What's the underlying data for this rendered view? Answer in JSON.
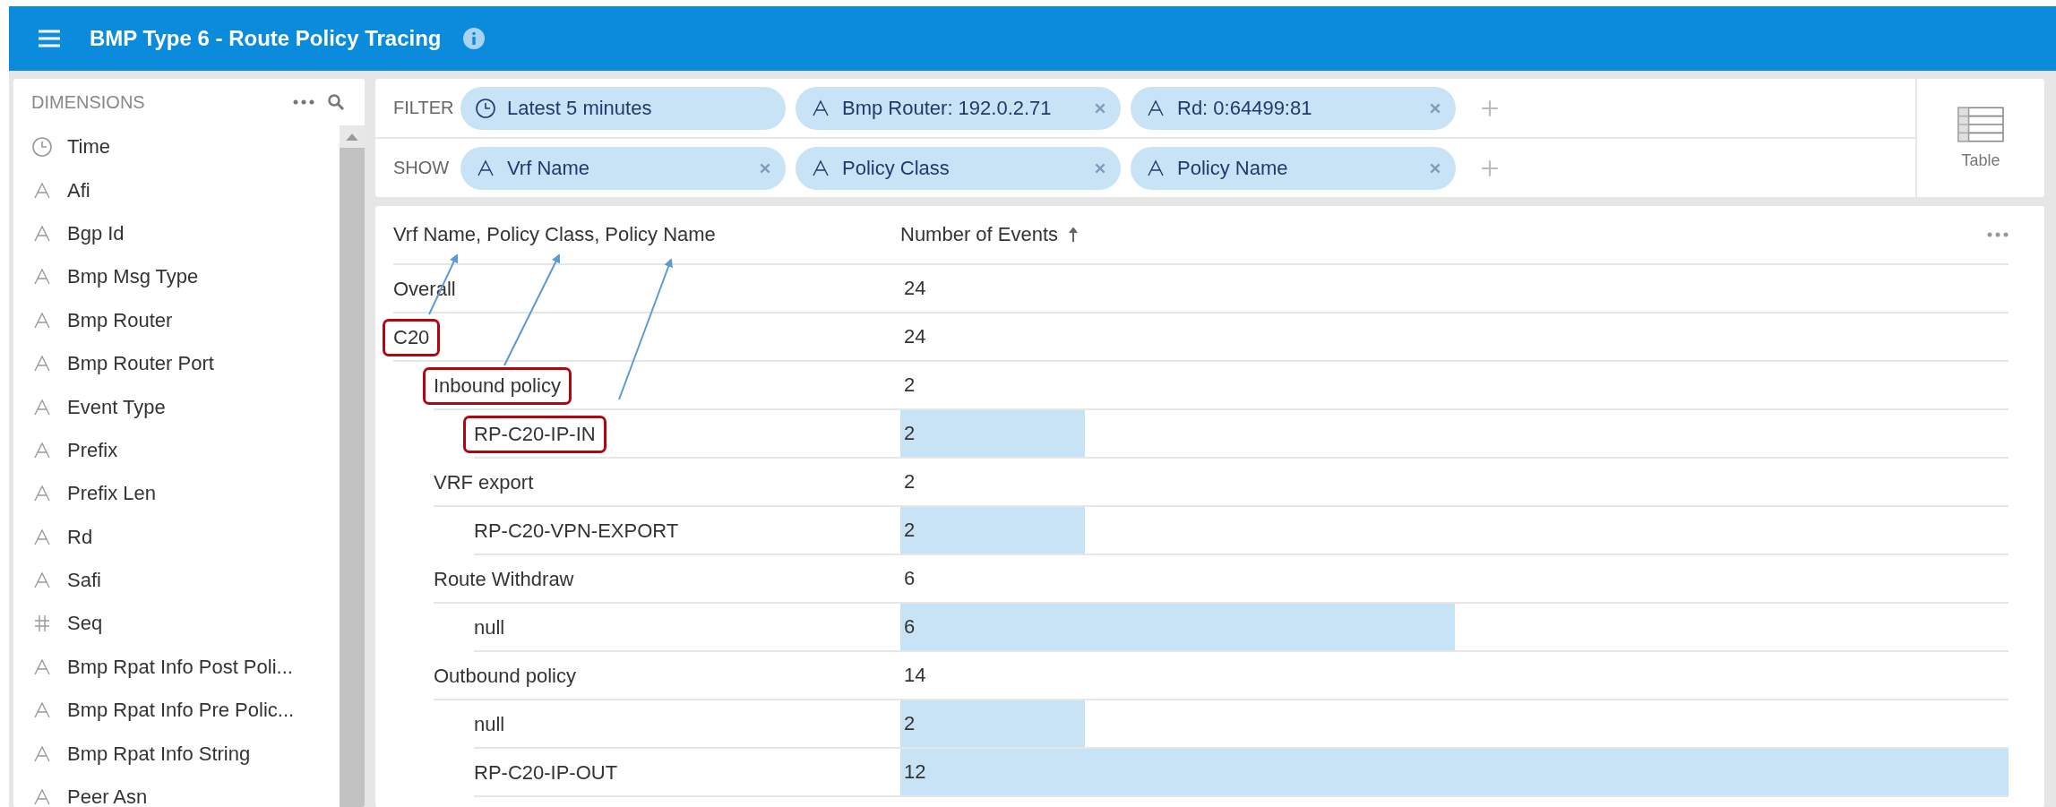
{
  "header": {
    "title": "BMP Type 6 - Route Policy Tracing"
  },
  "sidebar": {
    "title": "DIMENSIONS",
    "items": [
      {
        "label": "Time",
        "kind": "time"
      },
      {
        "label": "Afi",
        "kind": "string"
      },
      {
        "label": "Bgp Id",
        "kind": "string"
      },
      {
        "label": "Bmp Msg Type",
        "kind": "string"
      },
      {
        "label": "Bmp Router",
        "kind": "string"
      },
      {
        "label": "Bmp Router Port",
        "kind": "string"
      },
      {
        "label": "Event Type",
        "kind": "string"
      },
      {
        "label": "Prefix",
        "kind": "string"
      },
      {
        "label": "Prefix Len",
        "kind": "string"
      },
      {
        "label": "Rd",
        "kind": "string"
      },
      {
        "label": "Safi",
        "kind": "string"
      },
      {
        "label": "Seq",
        "kind": "number"
      },
      {
        "label": "Bmp Rpat Info Post Poli...",
        "kind": "string"
      },
      {
        "label": "Bmp Rpat Info Pre Polic...",
        "kind": "string"
      },
      {
        "label": "Bmp Rpat Info String",
        "kind": "string"
      },
      {
        "label": "Peer Asn",
        "kind": "string"
      }
    ]
  },
  "filter": {
    "label": "FILTER",
    "chips": [
      {
        "label": "Latest 5 minutes",
        "kind": "time",
        "removable": false
      },
      {
        "label": "Bmp Router: 192.0.2.71",
        "kind": "string",
        "removable": true
      },
      {
        "label": "Rd: 0:64499:81",
        "kind": "string",
        "removable": true
      }
    ]
  },
  "show": {
    "label": "SHOW",
    "chips": [
      {
        "label": "Vrf Name",
        "kind": "string",
        "removable": true
      },
      {
        "label": "Policy Class",
        "kind": "string",
        "removable": true
      },
      {
        "label": "Policy Name",
        "kind": "string",
        "removable": true
      }
    ]
  },
  "view": {
    "label": "Table"
  },
  "table": {
    "columns": [
      "Vrf Name, Policy Class, Policy Name",
      "Number of Events"
    ],
    "rows": [
      {
        "label": "Overall",
        "value": "24",
        "annotated": false
      },
      {
        "label": "C20",
        "value": "24",
        "annotated": true,
        "children": [
          {
            "label": "Inbound policy",
            "value": "2",
            "annotated": true,
            "children": [
              {
                "label": "RP-C20-IP-IN",
                "value": "2",
                "annotated": true
              }
            ]
          },
          {
            "label": "VRF export",
            "value": "2",
            "annotated": false,
            "children": [
              {
                "label": "RP-C20-VPN-EXPORT",
                "value": "2",
                "annotated": false
              }
            ]
          },
          {
            "label": "Route Withdraw",
            "value": "6",
            "annotated": false,
            "children": [
              {
                "label": "null",
                "value": "6",
                "annotated": false
              }
            ]
          },
          {
            "label": "Outbound policy",
            "value": "14",
            "annotated": false,
            "children": [
              {
                "label": "null",
                "value": "2",
                "annotated": false
              },
              {
                "label": "RP-C20-IP-OUT",
                "value": "12",
                "annotated": false
              }
            ]
          }
        ]
      }
    ]
  }
}
